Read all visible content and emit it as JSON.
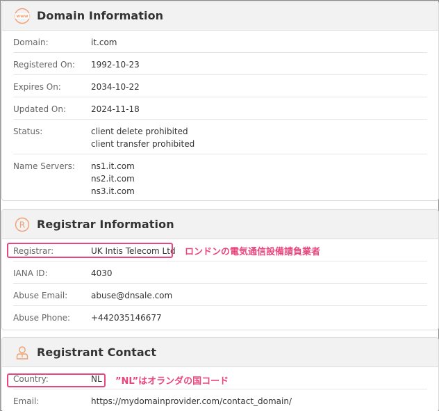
{
  "domain_info": {
    "title": "Domain Information",
    "rows": [
      {
        "label": "Domain:",
        "values": [
          "it.com"
        ]
      },
      {
        "label": "Registered On:",
        "values": [
          "1992-10-23"
        ]
      },
      {
        "label": "Expires On:",
        "values": [
          "2034-10-22"
        ]
      },
      {
        "label": "Updated On:",
        "values": [
          "2024-11-18"
        ]
      },
      {
        "label": "Status:",
        "values": [
          "client delete prohibited",
          "client transfer prohibited"
        ]
      },
      {
        "label": "Name Servers:",
        "values": [
          "ns1.it.com",
          "ns2.it.com",
          "ns3.it.com"
        ]
      }
    ]
  },
  "registrar_info": {
    "title": "Registrar Information",
    "rows": [
      {
        "label": "Registrar:",
        "values": [
          "UK Intis Telecom Ltd"
        ]
      },
      {
        "label": "IANA ID:",
        "values": [
          "4030"
        ]
      },
      {
        "label": "Abuse Email:",
        "values": [
          "abuse@dnsale.com"
        ]
      },
      {
        "label": "Abuse Phone:",
        "values": [
          "+442035146677"
        ]
      }
    ],
    "annotation": "ロンドンの電気通信設備請負業者"
  },
  "registrant_contact": {
    "title": "Registrant Contact",
    "rows": [
      {
        "label": "Country:",
        "values": [
          "NL"
        ]
      },
      {
        "label": "Email:",
        "values": [
          "https://mydomainprovider.com/contact_domain/"
        ]
      }
    ],
    "annotation": "”NL”はオランダの国コード"
  },
  "icons": {
    "domain": "www-globe-icon",
    "registrar": "registered-mark-icon",
    "registrant": "person-icon"
  },
  "colors": {
    "accent_icon": "#f0a070",
    "highlight": "#e8467c"
  }
}
